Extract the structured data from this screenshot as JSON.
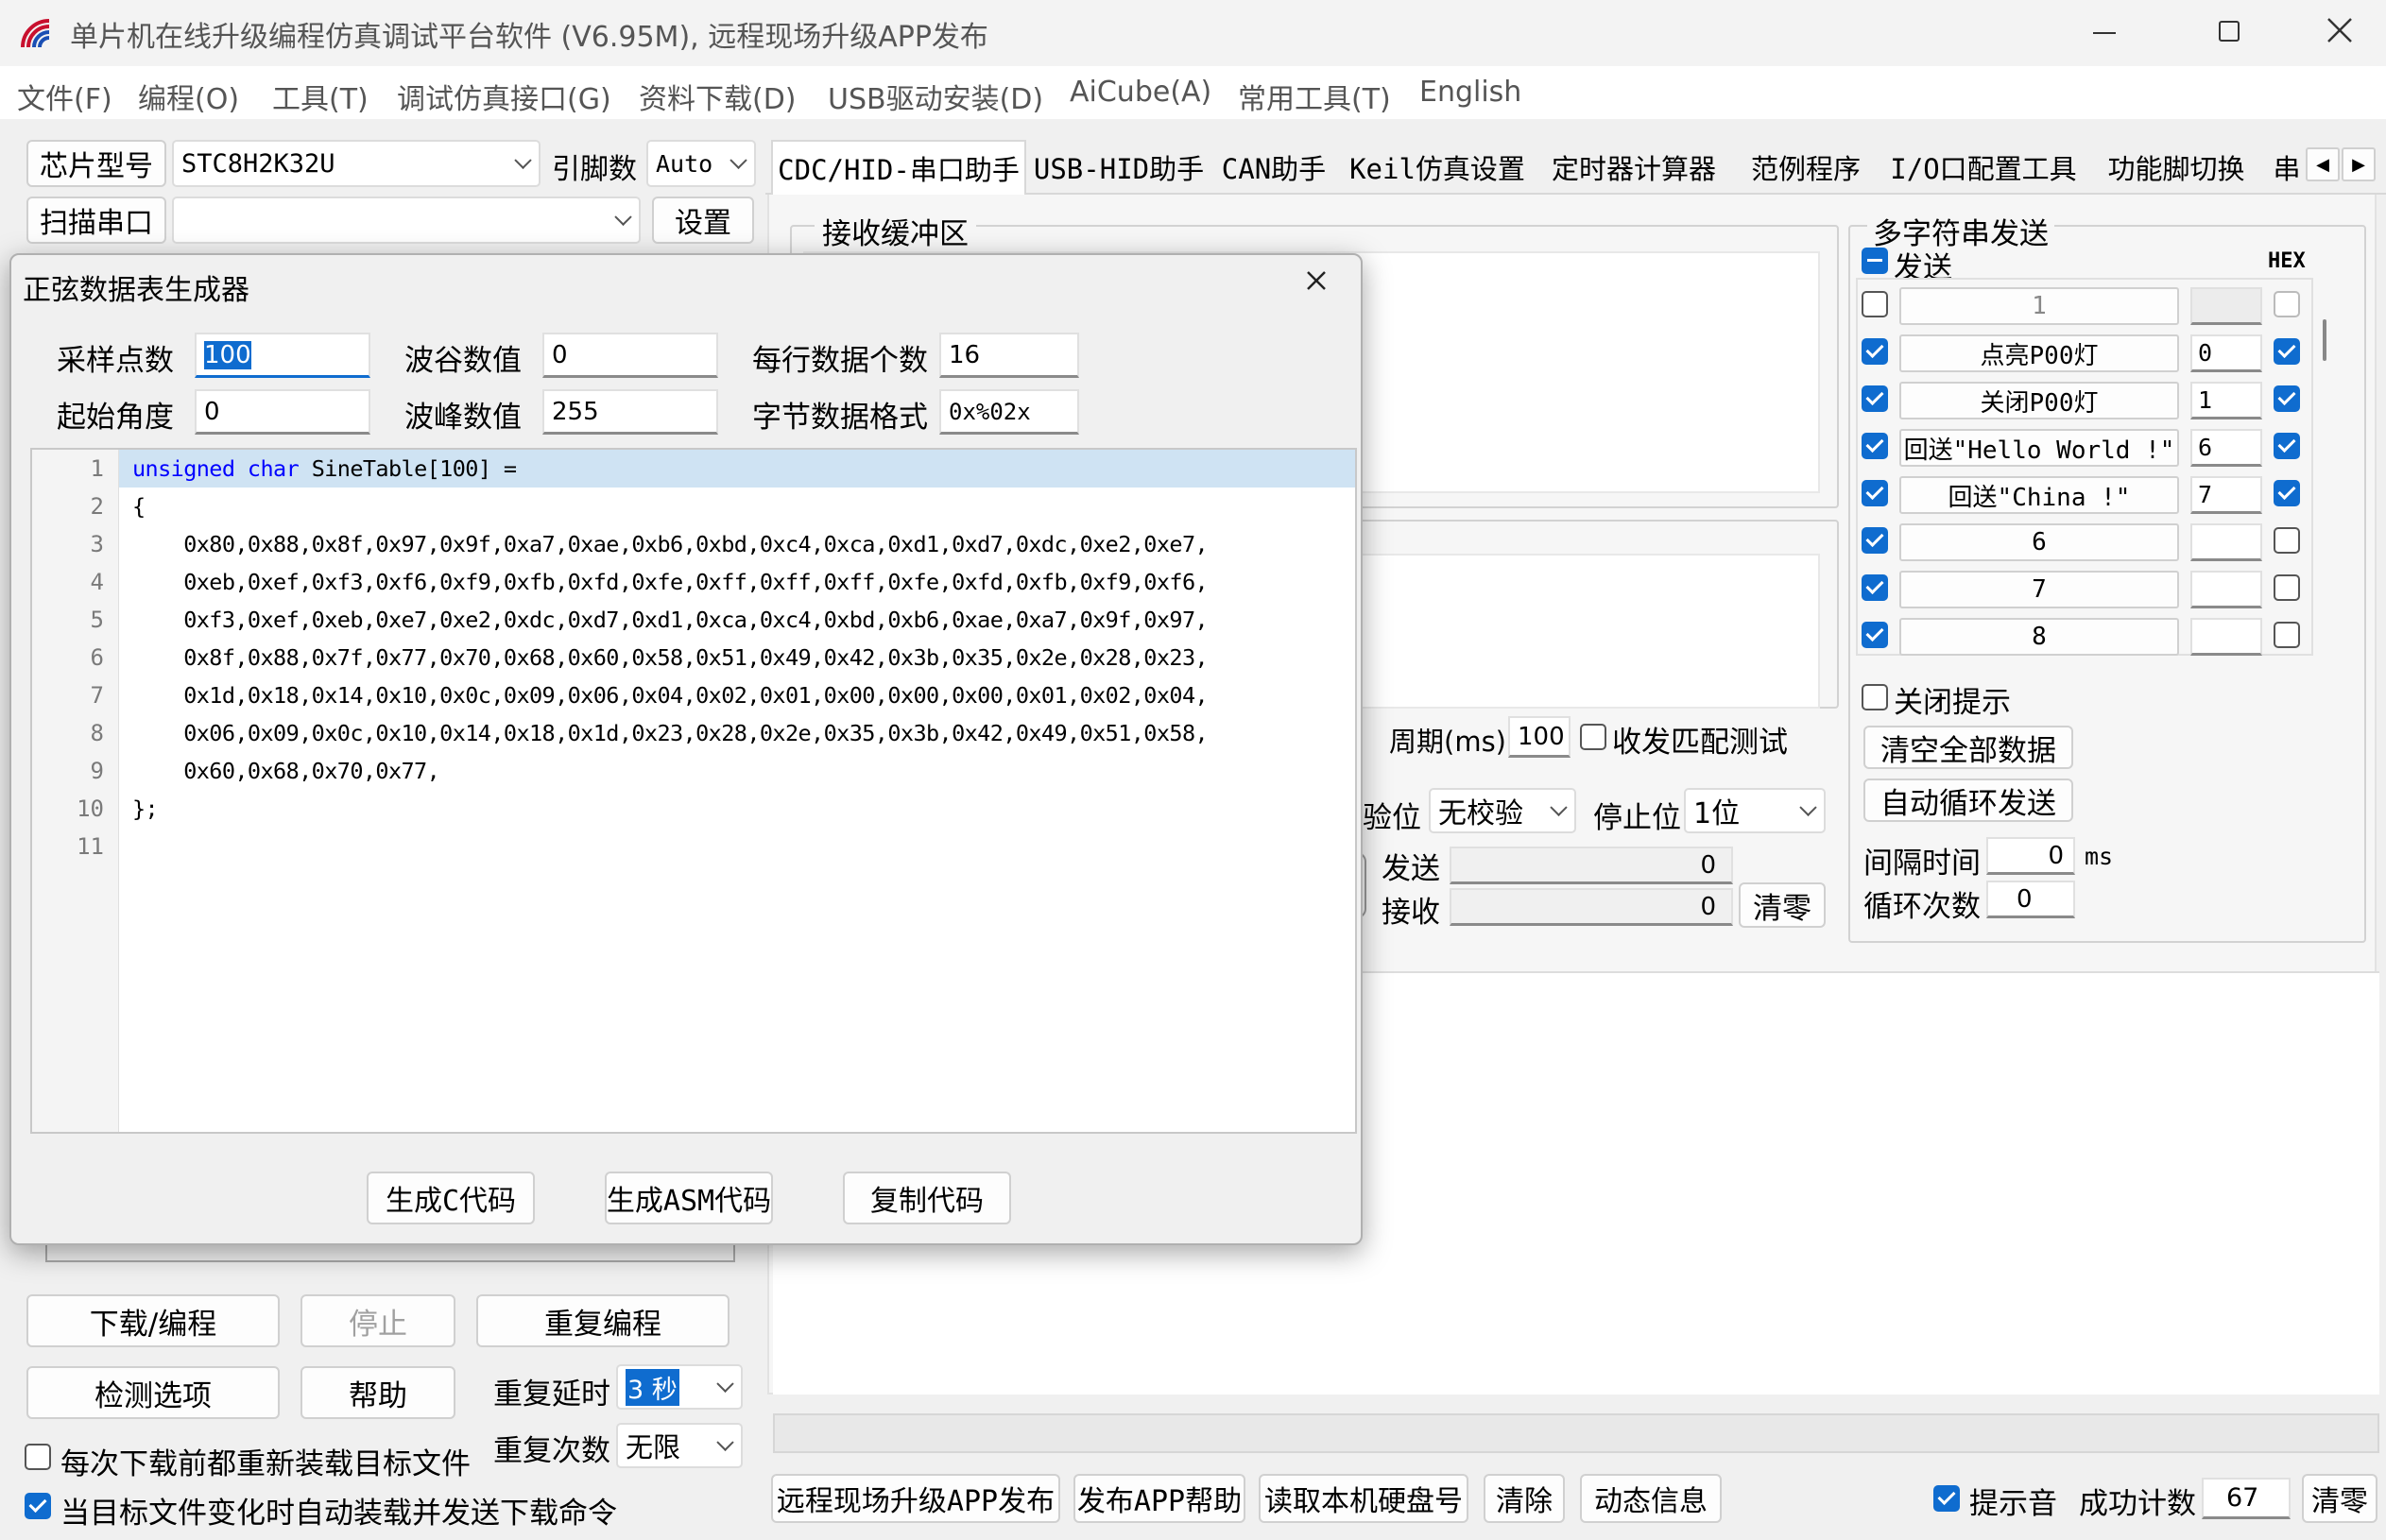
{
  "window": {
    "title": "单片机在线升级编程仿真调试平台软件 (V6.95M), 远程现场升级APP发布"
  },
  "menu": [
    "文件(F)",
    "编程(O)",
    "工具(T)",
    "调试仿真接口(G)",
    "资料下载(D)",
    "USB驱动安装(D)",
    "AiCube(A)",
    "常用工具(T)",
    "English"
  ],
  "left": {
    "chip_label": "芯片型号",
    "chip_value": "STC8H2K32U",
    "pin_label": "引脚数",
    "pin_value": "Auto",
    "scan_label": "扫描串口",
    "settings_label": "设置",
    "download_btn": "下载/编程",
    "stop_btn": "停止",
    "reprogram_btn": "重复编程",
    "check_btn": "检测选项",
    "help_btn": "帮助",
    "repeat_delay_label": "重复延时",
    "repeat_delay_value": "3 秒",
    "repeat_count_label": "重复次数",
    "repeat_count_value": "无限",
    "reload_label": "每次下载前都重新装载目标文件",
    "auto_label": "当目标文件变化时自动装载并发送下载命令"
  },
  "tabs": [
    "CDC/HID-串口助手",
    "USB-HID助手",
    "CAN助手",
    "Keil仿真设置",
    "定时器计算器",
    "范例程序",
    "I/O口配置工具",
    "功能脚切换",
    "串"
  ],
  "serial": {
    "recv_buffer_label": "接收缓冲区",
    "period_label": "周期(ms)",
    "period_value": "100",
    "match_test_label": "收发匹配测试",
    "parity_label": "验位",
    "parity_value": "无校验",
    "stopbit_label": "停止位",
    "stopbit_value": "1位",
    "send_label": "发送",
    "send_count": "0",
    "recv_label": "接收",
    "recv_count": "0",
    "clear_label": "清零"
  },
  "multi": {
    "title": "多字符串发送",
    "send_label": "发送",
    "hex_label": "HEX",
    "rows": [
      {
        "text": "1",
        "num": ""
      },
      {
        "text": "点亮P00灯",
        "num": "0"
      },
      {
        "text": "关闭P00灯",
        "num": "1"
      },
      {
        "text": "回送\"Hello World !\"",
        "num": "6"
      },
      {
        "text": "回送\"China !\"",
        "num": "7"
      },
      {
        "text": "6",
        "num": ""
      },
      {
        "text": "7",
        "num": ""
      },
      {
        "text": "8",
        "num": ""
      }
    ],
    "close_tip_label": "关闭提示",
    "clear_all_label": "清空全部数据",
    "auto_loop_label": "自动循环发送",
    "interval_label": "间隔时间",
    "interval_value": "0",
    "interval_unit": "ms",
    "loop_label": "循环次数",
    "loop_value": "0"
  },
  "bottom": {
    "remote_btn": "远程现场升级APP发布",
    "app_help_btn": "发布APP帮助",
    "disk_btn": "读取本机硬盘号",
    "clear_btn": "清除",
    "dynamic_btn": "动态信息",
    "beep_label": "提示音",
    "success_label": "成功计数",
    "success_value": "67",
    "zero_btn": "清零"
  },
  "dialog": {
    "title": "正弦数据表生成器",
    "samples_label": "采样点数",
    "samples_value": "100",
    "trough_label": "波谷数值",
    "trough_value": "0",
    "perline_label": "每行数据个数",
    "perline_value": "16",
    "start_label": "起始角度",
    "start_value": "0",
    "peak_label": "波峰数值",
    "peak_value": "255",
    "format_label": "字节数据格式",
    "format_value": "0x%02x",
    "code": [
      "unsigned char SineTable[100] =",
      "{",
      "    0x80,0x88,0x8f,0x97,0x9f,0xa7,0xae,0xb6,0xbd,0xc4,0xca,0xd1,0xd7,0xdc,0xe2,0xe7,",
      "    0xeb,0xef,0xf3,0xf6,0xf9,0xfb,0xfd,0xfe,0xff,0xff,0xff,0xfe,0xfd,0xfb,0xf9,0xf6,",
      "    0xf3,0xef,0xeb,0xe7,0xe2,0xdc,0xd7,0xd1,0xca,0xc4,0xbd,0xb6,0xae,0xa7,0x9f,0x97,",
      "    0x8f,0x88,0x7f,0x77,0x70,0x68,0x60,0x58,0x51,0x49,0x42,0x3b,0x35,0x2e,0x28,0x23,",
      "    0x1d,0x18,0x14,0x10,0x0c,0x09,0x06,0x04,0x02,0x01,0x00,0x00,0x00,0x01,0x02,0x04,",
      "    0x06,0x09,0x0c,0x10,0x14,0x18,0x1d,0x23,0x28,0x2e,0x35,0x3b,0x42,0x49,0x51,0x58,",
      "    0x60,0x68,0x70,0x77,",
      "};",
      ""
    ],
    "line_numbers": [
      "1",
      "2",
      "3",
      "4",
      "5",
      "6",
      "7",
      "8",
      "9",
      "10",
      "11"
    ],
    "gen_c_btn": "生成C代码",
    "gen_asm_btn": "生成ASM代码",
    "copy_btn": "复制代码"
  }
}
